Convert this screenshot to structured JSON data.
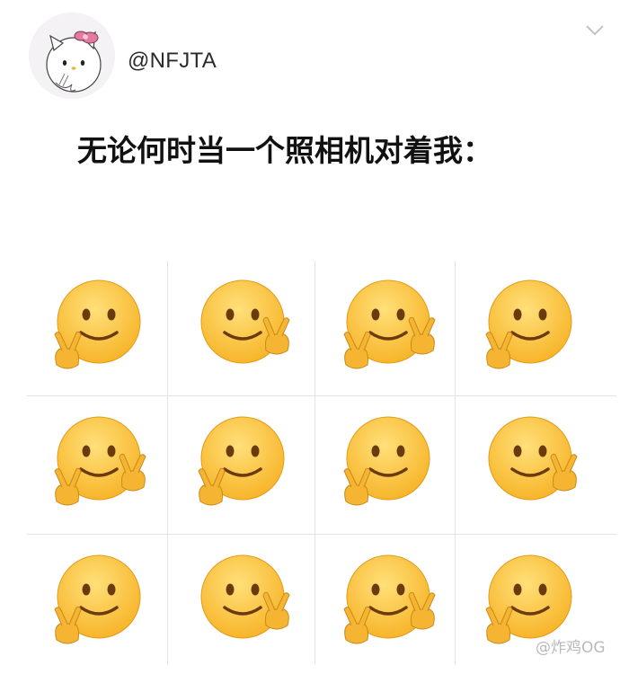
{
  "post": {
    "username": "@NFJTA",
    "text": "无论何时当一个照相机对着我："
  },
  "grid": {
    "rows": 3,
    "cols": 4,
    "cells": [
      {
        "emoji": "smiling-face",
        "hands": "left"
      },
      {
        "emoji": "smiling-face",
        "hands": "right"
      },
      {
        "emoji": "smiling-face",
        "hands": "both"
      },
      {
        "emoji": "smiling-face",
        "hands": "left"
      },
      {
        "emoji": "smiling-face",
        "hands": "both"
      },
      {
        "emoji": "smiling-face",
        "hands": "left"
      },
      {
        "emoji": "smiling-face",
        "hands": "left"
      },
      {
        "emoji": "smiling-face",
        "hands": "right"
      },
      {
        "emoji": "smiling-face",
        "hands": "left"
      },
      {
        "emoji": "smiling-face",
        "hands": "right"
      },
      {
        "emoji": "smiling-face",
        "hands": "both"
      },
      {
        "emoji": "smiling-face",
        "hands": "left"
      }
    ]
  },
  "watermark": "@炸鸡OG",
  "colors": {
    "face": "#f7b52a",
    "face_light": "#ffe07a",
    "hand": "#f5b533"
  }
}
